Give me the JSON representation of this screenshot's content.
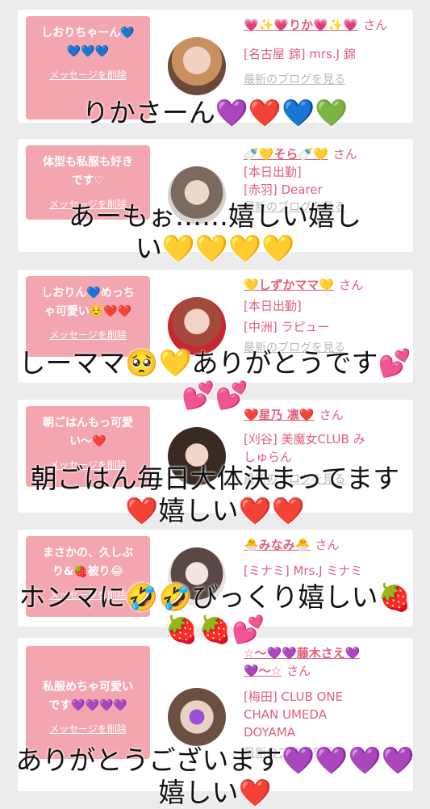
{
  "cards": [
    {
      "bubble": "しおりちゃーん💙\n💙💙💙",
      "delete": "メッセージを削除",
      "name": "💗✨💗りか💗✨💗",
      "san": "さん",
      "lines": [
        "[名古屋 錦] mrs.J 錦"
      ],
      "blog": "最新のブログを見る"
    },
    {
      "bubble": "体型も私服も好き\nです♡",
      "delete": "メッセージを削除",
      "name": "🍼💛そら🍼💛",
      "san": "さん",
      "lines": [
        "[本日出勤]",
        "[赤羽] Dearer"
      ],
      "blog": "最新のブログを見る"
    },
    {
      "bubble": "しおりん💙めっち\nゃ可愛い☺️❤️❤️",
      "delete": "メッセージを削除",
      "name": "💛しずかママ💛",
      "san": "さん",
      "lines": [
        "[本日出勤]",
        "[中洲] ラピュー"
      ],
      "blog": "最新のブログを見る"
    },
    {
      "bubble": "朝ごはんもっ可愛\nい〜❤️",
      "delete": "メッセージを削除",
      "name": "❤️星乃 凛❤️",
      "san": "さん",
      "lines": [
        "[刈谷] 美魔女CLUB み",
        "しゅらん"
      ],
      "blog": "最新のブログを見る"
    },
    {
      "bubble": "まさかの、久しぶ\nり&🍓被り😂",
      "delete": "メッセージを削除",
      "name": "🐣みなみ🐣",
      "san": "さん",
      "lines": [
        "[ミナミ] Mrs.J ミナミ"
      ],
      "blog": "最新のブログを見る"
    },
    {
      "bubble": "私服めちゃ可愛い\nです💜💜💜💜",
      "delete": "メッセージを削除",
      "name": "☆〜💜💜藤木さえ💜\n💜〜☆",
      "san": "さん",
      "lines": [
        "[梅田] CLUB ONE",
        "CHAN UMEDA",
        "DOYAMA"
      ],
      "blog": "最新のブログを見る"
    }
  ],
  "captions": [
    "りかさーん💜❤️💙💚",
    "あーもぉ……嬉しい嬉し\nい💛💛💛💛",
    "しーママ🥺💛ありがとうです💕\n💕💕",
    "朝ごはん毎日大体決まってます\n❤️嬉しい❤️❤️",
    "ホンマに🤣🤣びっくり嬉しい🍓\n🍓🍓💕",
    "ありがとうございます💜💜💜💜\n嬉しい❤️"
  ],
  "colors": {
    "accent": "#e0607a",
    "bubble": "#f4a6b0",
    "background": "#ececec",
    "muted": "#b9b9b9"
  }
}
